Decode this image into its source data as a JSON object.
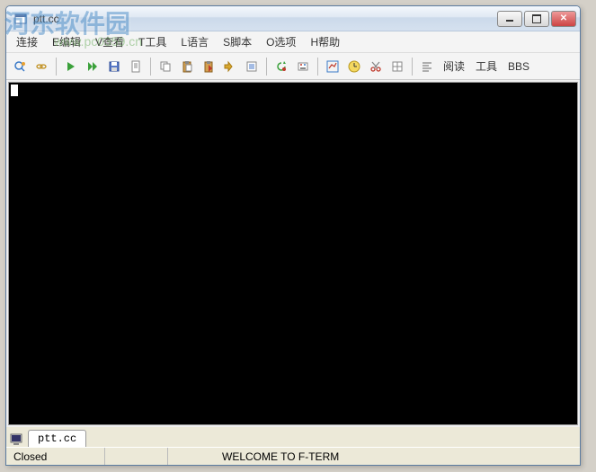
{
  "watermark": {
    "text": "河东软件园",
    "url": "www.pc0359.cn"
  },
  "title": "ptt.cc",
  "menu": {
    "connect": "连接",
    "edit": "E编辑",
    "view": "V查看",
    "tools": "T工具",
    "lang": "L语言",
    "script": "S脚本",
    "options": "O选项",
    "help": "H帮助"
  },
  "toolbar_text": {
    "read": "阅读",
    "tools": "工具",
    "bbs": "BBS"
  },
  "tab": {
    "label": "ptt.cc"
  },
  "status": {
    "state": "Closed",
    "message": "WELCOME TO F-TERM"
  }
}
